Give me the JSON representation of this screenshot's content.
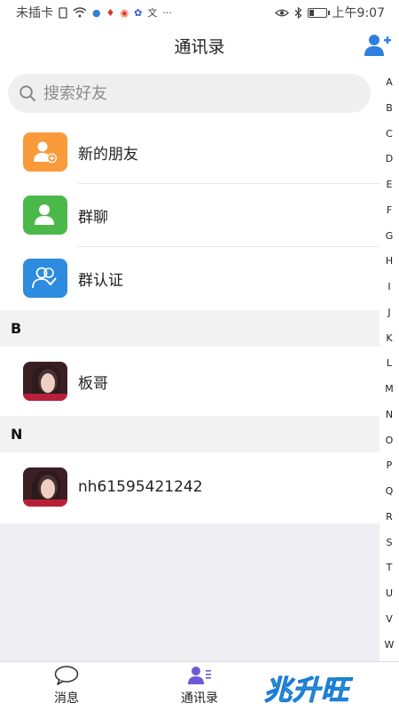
{
  "status_bar": {
    "carrier": "未插卡",
    "time": "上午9:07",
    "battery_fraction": 0.35
  },
  "header": {
    "title": "通讯录",
    "action_icon": "add-user-icon"
  },
  "search": {
    "placeholder": "搜索好友"
  },
  "fixed_items": [
    {
      "label": "新的朋友",
      "icon": "new-friend-icon",
      "color": "#f99a3b"
    },
    {
      "label": "群聊",
      "icon": "group-chat-icon",
      "color": "#4bb84a"
    },
    {
      "label": "群认证",
      "icon": "group-verify-icon",
      "color": "#2d8be0"
    }
  ],
  "sections": [
    {
      "letter": "B",
      "contacts": [
        {
          "name": "板哥"
        }
      ]
    },
    {
      "letter": "N",
      "contacts": [
        {
          "name": "nh61595421242"
        }
      ]
    }
  ],
  "alphabet": [
    "A",
    "B",
    "C",
    "D",
    "E",
    "F",
    "G",
    "H",
    "I",
    "J",
    "K",
    "L",
    "M",
    "N",
    "O",
    "P",
    "Q",
    "R",
    "S",
    "T",
    "U",
    "V",
    "W"
  ],
  "bottom_nav": {
    "tabs": [
      {
        "label": "消息",
        "icon": "message-icon",
        "active": false
      },
      {
        "label": "通讯录",
        "icon": "contacts-icon",
        "active": true
      }
    ],
    "brand": "兆升旺"
  },
  "colors": {
    "accent": "#2f7fe0",
    "brand_blue": "#1a7bd8",
    "brand_green": "#5ee07a",
    "brand_purple": "#b35ad9"
  }
}
